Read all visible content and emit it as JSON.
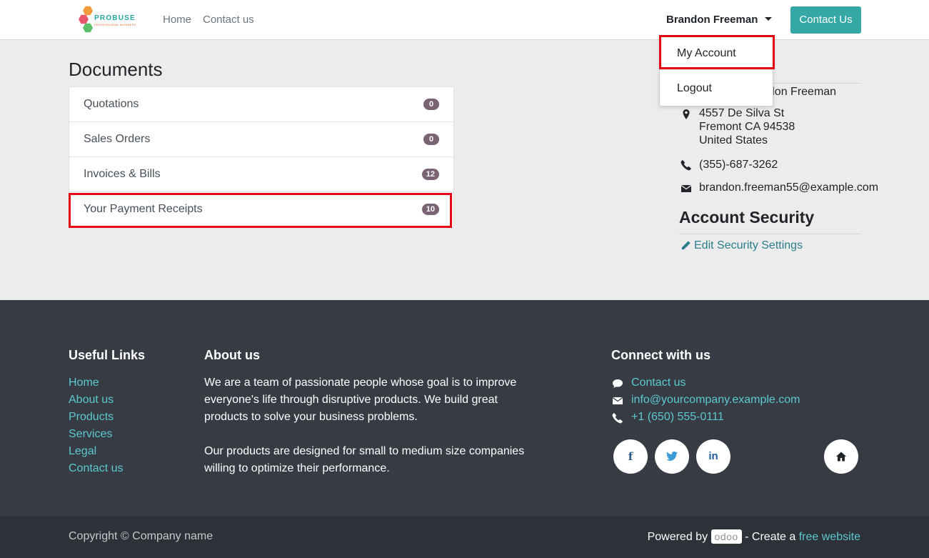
{
  "header": {
    "logo_text": "PROBUSE",
    "logo_sub": "PROFESSIONAL BUSINESS",
    "nav": [
      {
        "label": "Home"
      },
      {
        "label": "Contact us"
      }
    ],
    "user_name": "Brandon Freeman",
    "contact_button": "Contact Us"
  },
  "dropdown": {
    "items": [
      {
        "label": "My Account"
      },
      {
        "label": "Logout"
      }
    ]
  },
  "documents": {
    "title": "Documents",
    "items": [
      {
        "label": "Quotations",
        "count": "0"
      },
      {
        "label": "Sales Orders",
        "count": "0"
      },
      {
        "label": "Invoices & Bills",
        "count": "12"
      },
      {
        "label": "Your Payment Receipts",
        "count": "10"
      }
    ]
  },
  "details": {
    "name_partial": "ndon Freeman",
    "address": [
      "4557 De Silva St",
      "Fremont CA 94538",
      "United States"
    ],
    "phone": "(355)-687-3262",
    "email": "brandon.freeman55@example.com"
  },
  "security": {
    "title": "Account Security",
    "edit_link": "Edit Security Settings"
  },
  "footer": {
    "useful_links_title": "Useful Links",
    "useful_links": [
      {
        "label": "Home"
      },
      {
        "label": "About us"
      },
      {
        "label": "Products"
      },
      {
        "label": "Services"
      },
      {
        "label": "Legal"
      },
      {
        "label": "Contact us"
      }
    ],
    "about_title": "About us",
    "about_p1": "We are a team of passionate people whose goal is to improve everyone's life through disruptive products. We build great products to solve your business problems.",
    "about_p2": "Our products are designed for small to medium size companies willing to optimize their performance.",
    "connect_title": "Connect with us",
    "connect": [
      {
        "label": "Contact us"
      },
      {
        "label": "info@yourcompany.example.com"
      },
      {
        "label": "+1 (650) 555-0111"
      }
    ],
    "social": {
      "facebook": "f",
      "linkedin": "in"
    }
  },
  "bottom": {
    "copyright": "Copyright © Company name",
    "powered_prefix": "Powered by",
    "odoo": "odoo",
    "create_text": "- Create a",
    "free_website": "free website"
  },
  "colors": {
    "accent": "#35a8a5",
    "link": "#5cc8cf",
    "badge": "#7a6473",
    "highlight": "#e30613",
    "footer_bg": "#373c44"
  }
}
